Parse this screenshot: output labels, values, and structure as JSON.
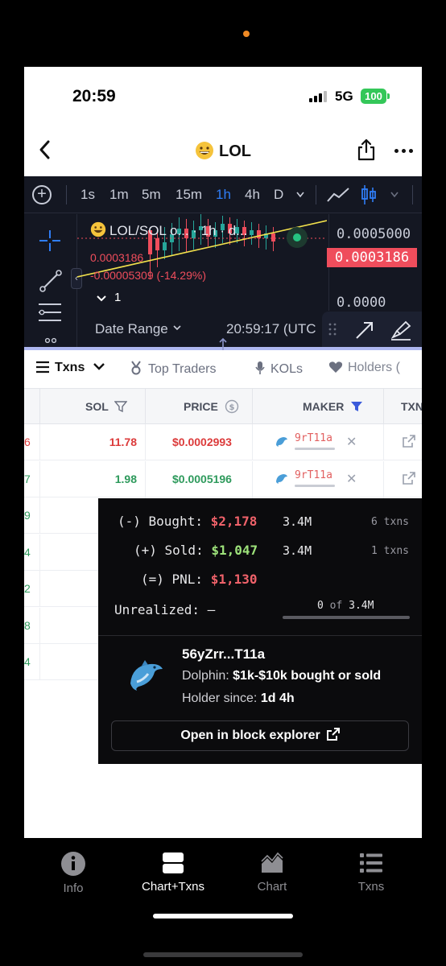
{
  "status": {
    "time": "20:59",
    "network": "5G",
    "battery": "100"
  },
  "header": {
    "title": "LOL"
  },
  "chart": {
    "timeframes": [
      {
        "label": "1s"
      },
      {
        "label": "1m"
      },
      {
        "label": "5m"
      },
      {
        "label": "15m"
      },
      {
        "label": "1h",
        "active": true
      },
      {
        "label": "4h"
      },
      {
        "label": "D"
      }
    ],
    "symbol_line": "LOL/SOL o... · 1h · d...",
    "ohlc_price": "0.0003186",
    "ohlc_change": "-0.00005309 (-14.29%)",
    "volume_toggle": "1",
    "axis_high": "0.0005000",
    "axis_current": "0.0003186",
    "axis_low": "0.0000",
    "date_range": "Date Range",
    "clock": "20:59:17 (UTC",
    "colors": {
      "up": "#26a69a",
      "down": "#ef4d5c",
      "trend": "#f2e14c"
    }
  },
  "tabs": [
    {
      "label": "Txns",
      "icon": "list-icon",
      "active": true
    },
    {
      "label": "Top Traders",
      "icon": "medal-icon"
    },
    {
      "label": "KOLs",
      "icon": "microphone-icon"
    },
    {
      "label": "Holders (",
      "icon": "heart-icon"
    }
  ],
  "table": {
    "headers": {
      "sol": "SOL",
      "price": "PRICE",
      "maker": "MAKER",
      "txn": "TXN"
    },
    "rows": [
      {
        "idx": "6",
        "sol": "11.78",
        "price": "$0.0002993",
        "maker": "9rT11a",
        "side": "sell"
      },
      {
        "idx": "7",
        "sol": "1.98",
        "price": "$0.0005196",
        "maker": "9rT11a",
        "side": "buy"
      },
      {
        "idx": "9",
        "side": "buy"
      },
      {
        "idx": "4",
        "side": "buy"
      },
      {
        "idx": "2",
        "side": "buy"
      },
      {
        "idx": "8",
        "side": "buy"
      },
      {
        "idx": "4",
        "side": "buy"
      }
    ]
  },
  "popup": {
    "bought_label": "(-) Bought:",
    "bought_value": "$2,178",
    "bought_qty": "3.4M",
    "bought_txns": "6 txns",
    "sold_label": "(+) Sold:",
    "sold_value": "$1,047",
    "sold_qty": "3.4M",
    "sold_txns": "1 txns",
    "pnl_label": "(=) PNL:",
    "pnl_value": "$1,130",
    "unrealized_label": "Unrealized: –",
    "unrealized_amount": "0",
    "unrealized_of": "of",
    "unrealized_total": "3.4M",
    "wallet": "56yZrr...T11a",
    "tier_label": "Dolphin:",
    "tier_value": "$1k-$10k bought or sold",
    "since_label": "Holder since:",
    "since_value": "1d 4h",
    "explorer_button": "Open in block explorer"
  },
  "bottom_nav": [
    {
      "label": "Info",
      "icon": "info-icon"
    },
    {
      "label": "Chart+Txns",
      "icon": "split-view-icon",
      "active": true
    },
    {
      "label": "Chart",
      "icon": "area-chart-icon"
    },
    {
      "label": "Txns",
      "icon": "list-icon"
    }
  ]
}
